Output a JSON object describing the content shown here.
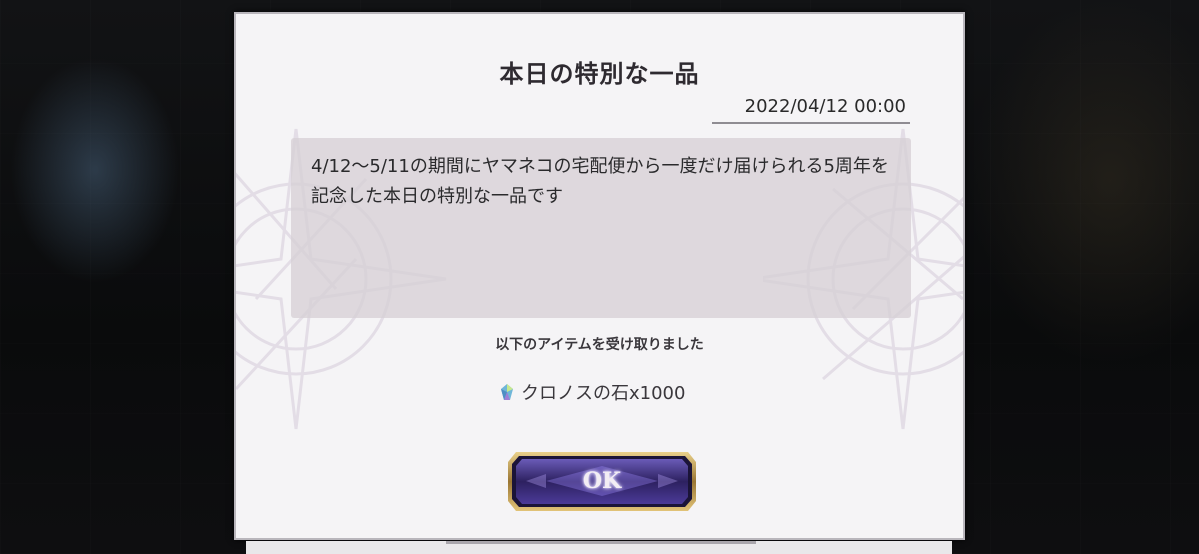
{
  "dialog": {
    "title": "本日の特別な一品",
    "date": "2022/04/12 00:00",
    "message": "4/12～5/11の期間にヤマネコの宅配便から一度だけ届けられる5周年を記念した本日の特別な一品です",
    "received_label": "以下のアイテムを受け取りました",
    "item": {
      "icon": "chronos-stone-icon",
      "name": "クロノスの石x1000"
    },
    "ok_label": "OK"
  },
  "colors": {
    "dialog_background": "#f5f4f6",
    "message_background": "#d6cfd4",
    "button_fill": "#3a2d78",
    "button_frame": "#c8a557"
  }
}
